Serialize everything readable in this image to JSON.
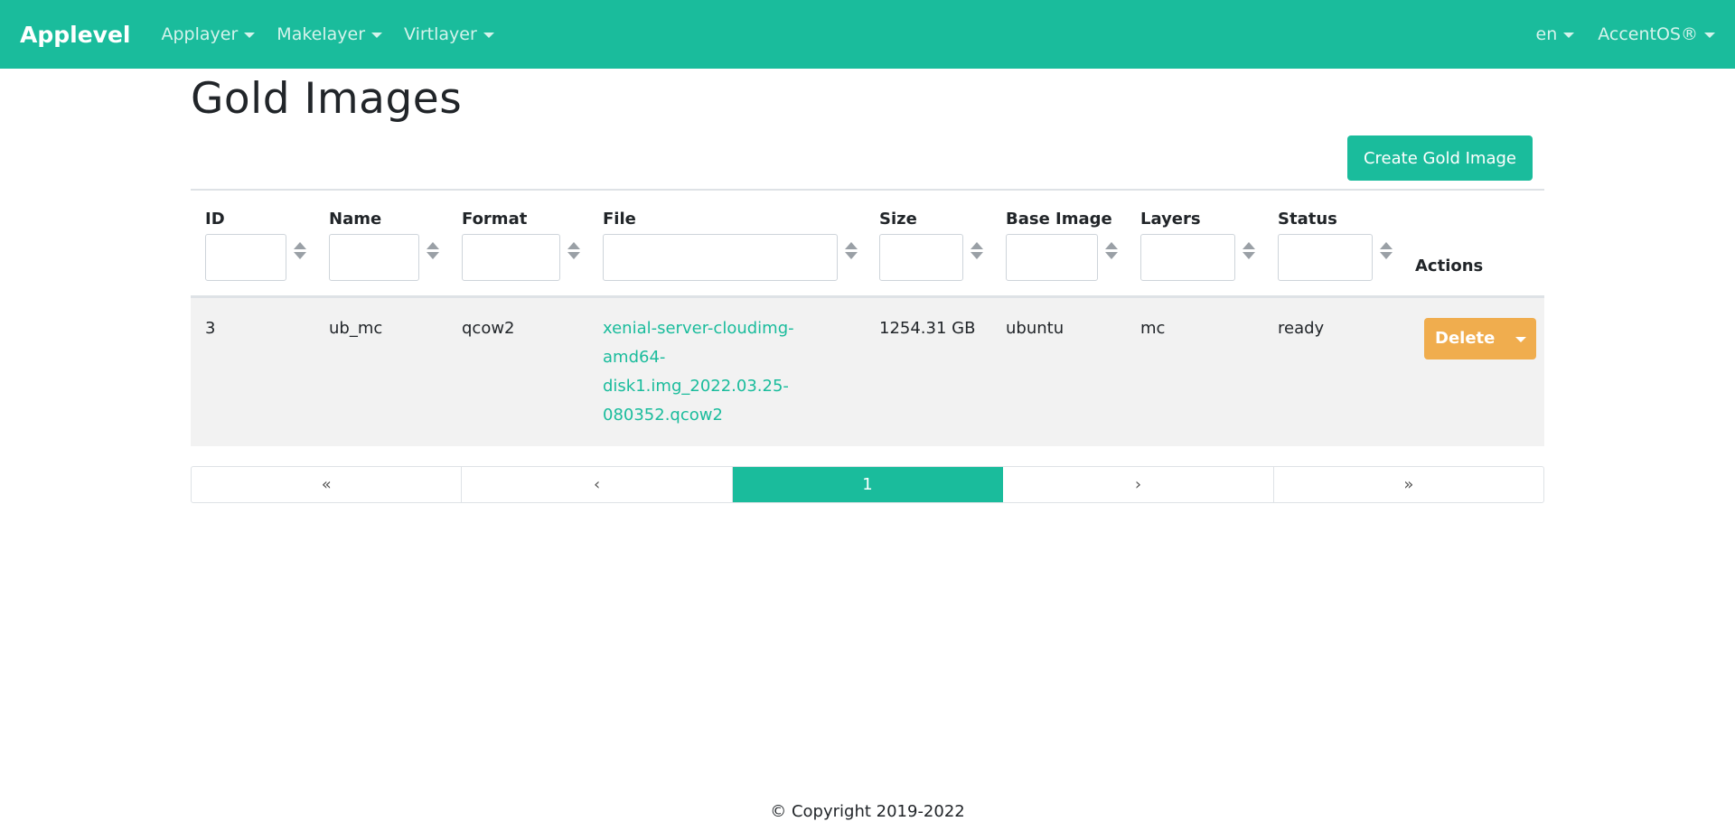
{
  "nav": {
    "brand": "Applevel",
    "menus": [
      "Applayer",
      "Makelayer",
      "Virtlayer"
    ],
    "lang": "en",
    "user": "AccentOS®"
  },
  "page": {
    "title": "Gold Images",
    "create_button": "Create Gold Image"
  },
  "table": {
    "columns": [
      "ID",
      "Name",
      "Format",
      "File",
      "Size",
      "Base Image",
      "Layers",
      "Status",
      "Actions"
    ],
    "rows": [
      {
        "id": "3",
        "name": "ub_mc",
        "format": "qcow2",
        "file": "xenial-server-cloudimg-amd64-disk1.img_2022.03.25-080352.qcow2",
        "size": "1254.31 GB",
        "base_image": "ubuntu",
        "layers": "mc",
        "status": "ready",
        "action": "Delete"
      }
    ]
  },
  "pagination": {
    "first": "«",
    "prev": "‹",
    "current": "1",
    "next": "›",
    "last": "»"
  },
  "footer": {
    "copyright": "© Copyright 2019-2022"
  },
  "colors": {
    "primary": "#1abc9c",
    "warning": "#f0ad4e"
  }
}
